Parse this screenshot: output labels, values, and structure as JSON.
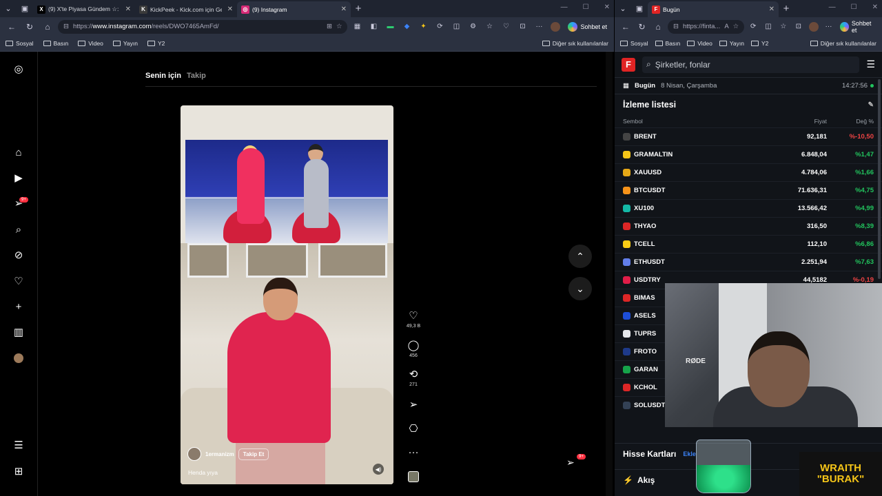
{
  "left_window": {
    "tabs": [
      {
        "label": "(9) X'te Piyasa Gündem ☆: \"● Ak...",
        "icon": "x-icon",
        "icon_char": "X",
        "color": "#000000"
      },
      {
        "label": "KickPeek - Kick.com için Gerçek Za...",
        "icon": "kickpeek-icon",
        "icon_char": "K",
        "color": "#3a3a3a"
      },
      {
        "label": "(9) Instagram",
        "icon": "instagram-icon",
        "icon_char": "◎",
        "color": "#d62976"
      }
    ],
    "url_prefix": "https://",
    "url_domain": "www.instagram.com",
    "url_path": "/reels/DWO7465AmFd/",
    "copilot": "Sohbet et",
    "bookmarks": [
      "Sosyal",
      "Basın",
      "Video",
      "Yayın",
      "Y2"
    ],
    "other_bookmarks": "Diğer sık kullanılanlar"
  },
  "instagram": {
    "feed_tabs": [
      "Senin için",
      "Takip"
    ],
    "notification_badge": "9+",
    "reel": {
      "username": "1ermanizm",
      "follow": "Takip Et",
      "caption": "Henda yıya"
    },
    "actions": [
      {
        "icon": "heart-icon",
        "glyph": "♡",
        "count": "49,3 B"
      },
      {
        "icon": "comment-icon",
        "glyph": "◯",
        "count": "456"
      },
      {
        "icon": "repost-icon",
        "glyph": "⟲",
        "count": "271"
      },
      {
        "icon": "share-icon",
        "glyph": "➢",
        "count": ""
      },
      {
        "icon": "bookmark-icon",
        "glyph": "⎔",
        "count": ""
      },
      {
        "icon": "more-icon",
        "glyph": "···",
        "count": ""
      }
    ],
    "messages_badge": "9+"
  },
  "right_window": {
    "tab": {
      "label": "Bugün",
      "icon_char": "F"
    },
    "url": "https://finta...",
    "copilot": "Sohbet et",
    "bookmarks": [
      "Sosyal",
      "Basın",
      "Video",
      "Yayın",
      "Y2"
    ],
    "other_bookmarks": "Diğer sık kullanılanlar"
  },
  "fintables": {
    "search_placeholder": "Şirketler, fonlar",
    "today_label": "Bugün",
    "date": "8 Nisan, Çarşamba",
    "time": "14:27:56",
    "watchlist_title": "İzleme listesi",
    "columns": {
      "symbol": "Sembol",
      "price": "Fiyat",
      "change": "Değ %"
    },
    "rows": [
      {
        "symbol": "BRENT",
        "price": "92,181",
        "change": "%-10,50",
        "dir": "neg",
        "color": "#444444"
      },
      {
        "symbol": "GRAMALTIN",
        "price": "6.848,04",
        "change": "%1,47",
        "dir": "pos",
        "color": "#f5c518"
      },
      {
        "symbol": "XAUUSD",
        "price": "4.784,06",
        "change": "%1,66",
        "dir": "pos",
        "color": "#e6a817"
      },
      {
        "symbol": "BTCUSDT",
        "price": "71.636,31",
        "change": "%4,75",
        "dir": "pos",
        "color": "#f7931a"
      },
      {
        "symbol": "XU100",
        "price": "13.566,42",
        "change": "%4,99",
        "dir": "pos",
        "color": "#14b8a6"
      },
      {
        "symbol": "THYAO",
        "price": "316,50",
        "change": "%8,39",
        "dir": "pos",
        "color": "#dc2626"
      },
      {
        "symbol": "TCELL",
        "price": "112,10",
        "change": "%6,86",
        "dir": "pos",
        "color": "#facc15"
      },
      {
        "symbol": "ETHUSDT",
        "price": "2.251,94",
        "change": "%7,63",
        "dir": "pos",
        "color": "#627eea"
      },
      {
        "symbol": "USDTRY",
        "price": "44,5182",
        "change": "%-0,19",
        "dir": "neg",
        "color": "#e11d48"
      },
      {
        "symbol": "BIMAS",
        "price": "",
        "change": "",
        "dir": "pos",
        "color": "#dc2626"
      },
      {
        "symbol": "ASELS",
        "price": "",
        "change": "",
        "dir": "pos",
        "color": "#1d4ed8"
      },
      {
        "symbol": "TUPRS",
        "price": "",
        "change": "",
        "dir": "pos",
        "color": "#e5e7eb"
      },
      {
        "symbol": "FROTO",
        "price": "",
        "change": "",
        "dir": "pos",
        "color": "#1e3a8a"
      },
      {
        "symbol": "GARAN",
        "price": "",
        "change": "",
        "dir": "pos",
        "color": "#16a34a"
      },
      {
        "symbol": "KCHOL",
        "price": "",
        "change": "",
        "dir": "pos",
        "color": "#dc2626"
      },
      {
        "symbol": "SOLUSDT",
        "price": "",
        "change": "",
        "dir": "pos",
        "color": "#334155"
      }
    ],
    "cards_title": "Hisse Kartları",
    "cards_add": "Ekle",
    "flow_title": "Akış"
  },
  "overlay": {
    "mic_brand": "RØDE",
    "brand_line1": "WRAITH",
    "brand_line2": "\"BURAK\""
  }
}
